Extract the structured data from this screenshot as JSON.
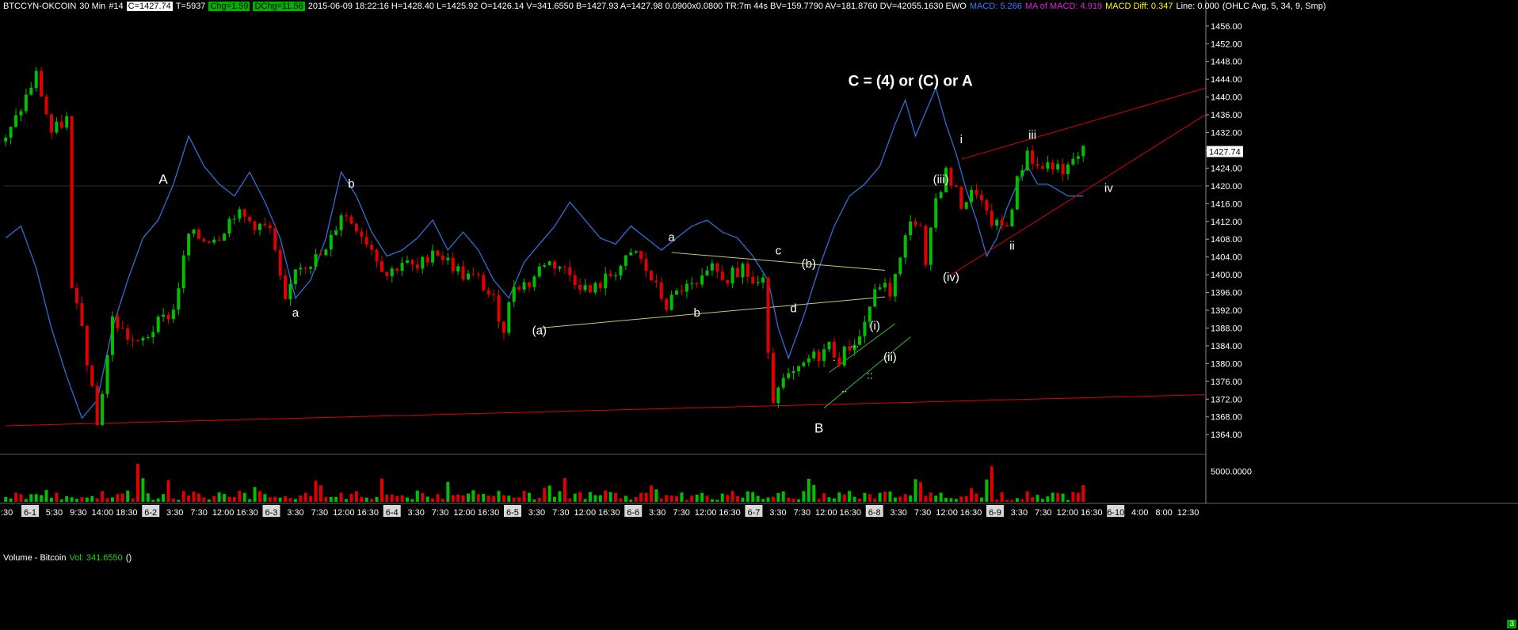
{
  "header": {
    "symbol": "BTCCYN-OKCOIN",
    "interval": "30 Min",
    "bar_no": "#14",
    "close": "C=1427.74",
    "ticks": "T=5937",
    "chg": "Chg=1.59",
    "dchg": "DChg=11.56",
    "details": "2015-06-09 18:22:16 H=1428.40 L=1425.92 O=1426.14 V=341.6550 B=1427.93 A=1427.98 0.0900x0.0800 TR:7m 44s BV=159.7790 AV=181.8760 DV=42055.1630 EWO",
    "macd": "MACD: 5.266",
    "ma_macd": "MA of MACD: 4.919",
    "macd_diff": "MACD Diff: 0.347",
    "line": "Line: 0.000",
    "study": "(OHLC Avg, 5, 34, 9, Smp)"
  },
  "volume_header": {
    "title": "Volume - Bitcoin",
    "vol": "Vol: 341.6550",
    "paren": "()"
  },
  "corner_badge": "3",
  "last_price_tag": "1427.74",
  "colors": {
    "background": "#000000",
    "up_candle": "#00c000",
    "down_candle": "#e00000",
    "oscillator": "#2f6fd6",
    "trendline_red": "#e00000",
    "triangle_olive": "#c8c870",
    "channel_green": "#30c030",
    "axis_text": "#ffffff"
  },
  "chart_data": [
    {
      "type": "candlestick",
      "title": "",
      "price_axis_ticks": [
        "1456.00",
        "1452.00",
        "1448.00",
        "1444.00",
        "1440.00",
        "1436.00",
        "1432.00",
        "1428.00",
        "1424.00",
        "1420.00",
        "1416.00",
        "1412.00",
        "1408.00",
        "1404.00",
        "1400.00",
        "1396.00",
        "1392.00",
        "1388.00",
        "1384.00",
        "1380.00",
        "1376.00",
        "1372.00",
        "1368.00",
        "1364.00"
      ],
      "ylim": [
        1361,
        1459
      ],
      "time_axis": [
        {
          "label": "6-1",
          "day": true
        },
        {
          "label": "5:30"
        },
        {
          "label": "9:30"
        },
        {
          "label": "14:00"
        },
        {
          "label": "18:30"
        },
        {
          "label": "6-2",
          "day": true
        },
        {
          "label": "3:30"
        },
        {
          "label": "7:30"
        },
        {
          "label": "12:00"
        },
        {
          "label": "16:30"
        },
        {
          "label": "6-3",
          "day": true
        },
        {
          "label": "3:30"
        },
        {
          "label": "7:30"
        },
        {
          "label": "12:00"
        },
        {
          "label": "16:30"
        },
        {
          "label": "6-4",
          "day": true
        },
        {
          "label": "3:30"
        },
        {
          "label": "7:30"
        },
        {
          "label": "12:00"
        },
        {
          "label": "16:30"
        },
        {
          "label": "6-5",
          "day": true
        },
        {
          "label": "3:30"
        },
        {
          "label": "7:30"
        },
        {
          "label": "12:00"
        },
        {
          "label": "16:30"
        },
        {
          "label": "6-6",
          "day": true
        },
        {
          "label": "3:30"
        },
        {
          "label": "7:30"
        },
        {
          "label": "12:00"
        },
        {
          "label": "16:30"
        },
        {
          "label": "6-7",
          "day": true
        },
        {
          "label": "3:30"
        },
        {
          "label": "7:30"
        },
        {
          "label": "12:00"
        },
        {
          "label": "16:30"
        },
        {
          "label": "6-8",
          "day": true
        },
        {
          "label": "3:30"
        },
        {
          "label": "7:30"
        },
        {
          "label": "12:00"
        },
        {
          "label": "16:30"
        },
        {
          "label": "6-9",
          "day": true
        },
        {
          "label": "3:30"
        },
        {
          "label": "7:30"
        },
        {
          "label": "12:00"
        },
        {
          "label": "16:30"
        },
        {
          "label": "6-10",
          "day": true
        },
        {
          "label": "4:00"
        },
        {
          "label": "8:00"
        },
        {
          "label": "12:30"
        }
      ],
      "first_axis_label": ":30",
      "price_path": [
        [
          0,
          1430
        ],
        [
          6,
          1445
        ],
        [
          9,
          1432
        ],
        [
          12,
          1435
        ],
        [
          13,
          1396
        ],
        [
          15,
          1388
        ],
        [
          18,
          1366
        ],
        [
          21,
          1390
        ],
        [
          24,
          1386
        ],
        [
          26,
          1384
        ],
        [
          30,
          1389
        ],
        [
          33,
          1392
        ],
        [
          36,
          1409
        ],
        [
          39,
          1408
        ],
        [
          42,
          1409
        ],
        [
          45,
          1414
        ],
        [
          48,
          1412
        ],
        [
          52,
          1410
        ],
        [
          55,
          1393
        ],
        [
          57,
          1402
        ],
        [
          60,
          1403
        ],
        [
          63,
          1405
        ],
        [
          66,
          1414
        ],
        [
          69,
          1411
        ],
        [
          72,
          1406
        ],
        [
          75,
          1400
        ],
        [
          78,
          1403
        ],
        [
          81,
          1401
        ],
        [
          84,
          1406
        ],
        [
          87,
          1403
        ],
        [
          90,
          1400
        ],
        [
          93,
          1399
        ],
        [
          96,
          1394
        ],
        [
          98,
          1388
        ],
        [
          100,
          1398
        ],
        [
          103,
          1398
        ],
        [
          106,
          1403
        ],
        [
          109,
          1402
        ],
        [
          112,
          1399
        ],
        [
          115,
          1396
        ],
        [
          118,
          1399
        ],
        [
          121,
          1402
        ],
        [
          124,
          1405
        ],
        [
          127,
          1399
        ],
        [
          130,
          1393
        ],
        [
          133,
          1397
        ],
        [
          136,
          1397
        ],
        [
          139,
          1401
        ],
        [
          142,
          1399
        ],
        [
          145,
          1402
        ],
        [
          147,
          1398
        ],
        [
          149,
          1398
        ],
        [
          150,
          1384
        ],
        [
          151,
          1372
        ],
        [
          152,
          1373
        ],
        [
          153,
          1376
        ],
        [
          156,
          1378
        ],
        [
          158,
          1381
        ],
        [
          160,
          1382
        ],
        [
          162,
          1384
        ],
        [
          164,
          1381
        ],
        [
          166,
          1384
        ],
        [
          168,
          1386
        ],
        [
          170,
          1393
        ],
        [
          172,
          1398
        ],
        [
          174,
          1396
        ],
        [
          176,
          1403
        ],
        [
          178,
          1413
        ],
        [
          180,
          1410
        ],
        [
          181,
          1401
        ],
        [
          183,
          1417
        ],
        [
          185,
          1423
        ],
        [
          188,
          1416
        ],
        [
          191,
          1419
        ],
        [
          193,
          1413
        ],
        [
          195,
          1411
        ],
        [
          197,
          1411
        ],
        [
          199,
          1421
        ],
        [
          201,
          1428
        ],
        [
          203,
          1424
        ],
        [
          206,
          1425
        ],
        [
          208,
          1422
        ],
        [
          210,
          1426
        ],
        [
          212,
          1427.74
        ]
      ],
      "oscillator": {
        "name": "EWO",
        "ylim": [
          -34,
          24
        ],
        "points": [
          [
            0,
            -3
          ],
          [
            3,
            -1
          ],
          [
            6,
            -8
          ],
          [
            9,
            -18
          ],
          [
            12,
            -26
          ],
          [
            15,
            -33
          ],
          [
            18,
            -30
          ],
          [
            21,
            -18
          ],
          [
            24,
            -10
          ],
          [
            27,
            -3
          ],
          [
            30,
            0
          ],
          [
            33,
            6
          ],
          [
            36,
            14
          ],
          [
            39,
            9
          ],
          [
            42,
            6
          ],
          [
            45,
            4
          ],
          [
            48,
            8
          ],
          [
            51,
            3
          ],
          [
            54,
            -3
          ],
          [
            57,
            -13
          ],
          [
            60,
            -10
          ],
          [
            63,
            -3
          ],
          [
            66,
            8
          ],
          [
            69,
            4
          ],
          [
            72,
            -2
          ],
          [
            75,
            -6
          ],
          [
            78,
            -5
          ],
          [
            81,
            -3
          ],
          [
            84,
            0
          ],
          [
            87,
            -5
          ],
          [
            90,
            -2
          ],
          [
            93,
            -5
          ],
          [
            96,
            -10
          ],
          [
            99,
            -13
          ],
          [
            102,
            -7
          ],
          [
            105,
            -4
          ],
          [
            108,
            -1
          ],
          [
            111,
            3
          ],
          [
            114,
            0
          ],
          [
            117,
            -3
          ],
          [
            120,
            -4
          ],
          [
            123,
            -1
          ],
          [
            126,
            -3
          ],
          [
            129,
            -5
          ],
          [
            132,
            -3
          ],
          [
            135,
            -1
          ],
          [
            138,
            0
          ],
          [
            141,
            -2
          ],
          [
            144,
            -3
          ],
          [
            147,
            -6
          ],
          [
            150,
            -10
          ],
          [
            152,
            -18
          ],
          [
            154,
            -23
          ],
          [
            157,
            -16
          ],
          [
            160,
            -8
          ],
          [
            163,
            -1
          ],
          [
            166,
            4
          ],
          [
            169,
            6
          ],
          [
            172,
            9
          ],
          [
            175,
            16
          ],
          [
            177,
            20
          ],
          [
            179,
            14
          ],
          [
            181,
            18
          ],
          [
            183,
            22
          ],
          [
            185,
            16
          ],
          [
            187,
            11
          ],
          [
            189,
            5
          ],
          [
            191,
            0
          ],
          [
            193,
            -6
          ],
          [
            195,
            -3
          ],
          [
            197,
            2
          ],
          [
            199,
            6
          ],
          [
            201,
            9
          ],
          [
            203,
            6
          ],
          [
            205,
            6
          ],
          [
            207,
            5
          ],
          [
            209,
            4
          ],
          [
            212,
            4
          ]
        ]
      }
    },
    {
      "type": "bar",
      "title": "Volume - Bitcoin",
      "ylim": [
        0,
        7000
      ],
      "axis_ticks": [
        "5000.0000"
      ],
      "last_value": 341.655
    }
  ],
  "annotations": [
    {
      "text": "C = (4) or (C) or A",
      "bar": 178,
      "price": 1442.5,
      "size": 19,
      "bold": true
    },
    {
      "text": "A",
      "bar": 31,
      "price": 1420.5,
      "size": 17
    },
    {
      "text": "a",
      "bar": 57,
      "price": 1390.6,
      "size": 15
    },
    {
      "text": "b",
      "bar": 68,
      "price": 1419.6,
      "size": 15
    },
    {
      "text": "(a)",
      "bar": 105,
      "price": 1386.6,
      "size": 15
    },
    {
      "text": "a",
      "bar": 131,
      "price": 1407.6,
      "size": 15
    },
    {
      "text": "b",
      "bar": 136,
      "price": 1390.6,
      "size": 15
    },
    {
      "text": "c",
      "bar": 152,
      "price": 1404.6,
      "size": 15
    },
    {
      "text": "(b)",
      "bar": 158,
      "price": 1401.6,
      "size": 15
    },
    {
      "text": "d",
      "bar": 155,
      "price": 1391.6,
      "size": 15
    },
    {
      "text": "B",
      "bar": 160,
      "price": 1364.5,
      "size": 17
    },
    {
      "text": "(i)",
      "bar": 171,
      "price": 1387.6,
      "size": 15
    },
    {
      "text": "(ii)",
      "bar": 174,
      "price": 1380.6,
      "size": 15
    },
    {
      "text": ".",
      "bar": 163,
      "price": 1380.6,
      "size": 13
    },
    {
      "text": "...",
      "bar": 167,
      "price": 1383.6,
      "size": 13
    },
    {
      "text": "..",
      "bar": 165,
      "price": 1373.6,
      "size": 13
    },
    {
      "text": "::",
      "bar": 170,
      "price": 1376.6,
      "size": 13
    },
    {
      "text": "(iii)",
      "bar": 184,
      "price": 1420.6,
      "size": 15
    },
    {
      "text": "(iv)",
      "bar": 186,
      "price": 1398.6,
      "size": 15
    },
    {
      "text": "i",
      "bar": 188,
      "price": 1429.6,
      "size": 15
    },
    {
      "text": "ii",
      "bar": 198,
      "price": 1405.6,
      "size": 15
    },
    {
      "text": "iii",
      "bar": 202,
      "price": 1430.6,
      "size": 15
    },
    {
      "text": "iv",
      "bar": 217,
      "price": 1418.6,
      "size": 15
    }
  ],
  "trendlines": [
    {
      "color": "red",
      "from": [
        0,
        1366
      ],
      "to": [
        236,
        1373
      ]
    },
    {
      "color": "olive",
      "from": [
        105,
        1388
      ],
      "to": [
        173,
        1395
      ]
    },
    {
      "color": "olive",
      "from": [
        131,
        1405
      ],
      "to": [
        173,
        1401
      ]
    },
    {
      "color": "green",
      "from": [
        161,
        1370
      ],
      "to": [
        178,
        1386
      ]
    },
    {
      "color": "green",
      "from": [
        162,
        1378
      ],
      "to": [
        175,
        1389
      ]
    },
    {
      "color": "red",
      "from": [
        188,
        1426
      ],
      "to": [
        236,
        1442
      ]
    },
    {
      "color": "red",
      "from": [
        186,
        1400
      ],
      "to": [
        236,
        1436
      ]
    }
  ]
}
